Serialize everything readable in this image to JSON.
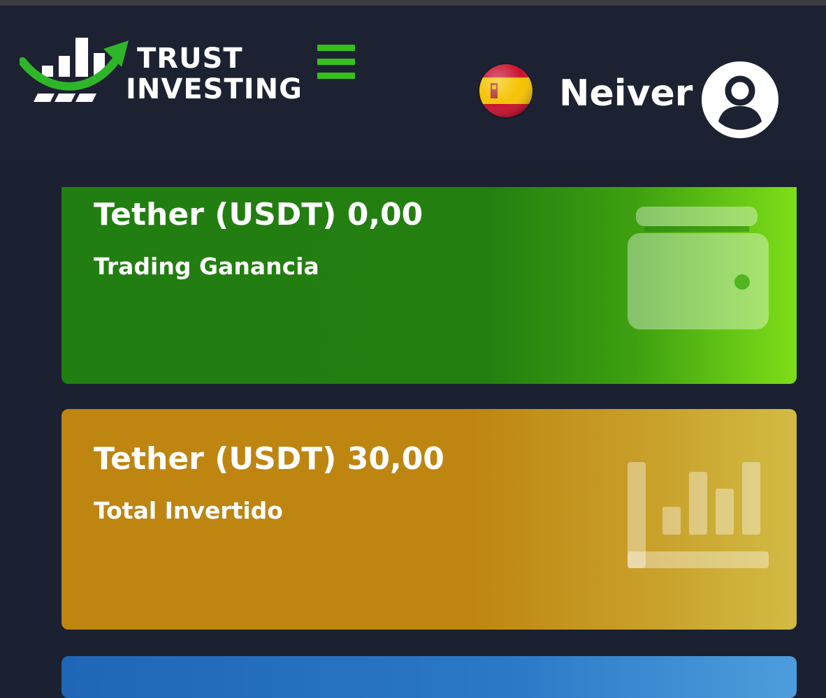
{
  "header": {
    "logo": {
      "line1": "TRUST",
      "line2": "INVESTING"
    },
    "menu_icon": "hamburger-icon",
    "language_flag": "spain-flag-icon",
    "username": "Neiver",
    "avatar_icon": "user-avatar-icon"
  },
  "cards": [
    {
      "amount": "Tether (USDT) 0,00",
      "label": "Trading Ganancia",
      "icon": "wallet-icon",
      "color": "#217e10"
    },
    {
      "amount": "Tether (USDT) 30,00",
      "label": "Total Invertido",
      "icon": "bar-chart-icon",
      "color": "#be8510"
    },
    {
      "color": "#2a78c6"
    }
  ],
  "colors": {
    "background": "#1c2231",
    "accent_green": "#37c01d"
  }
}
